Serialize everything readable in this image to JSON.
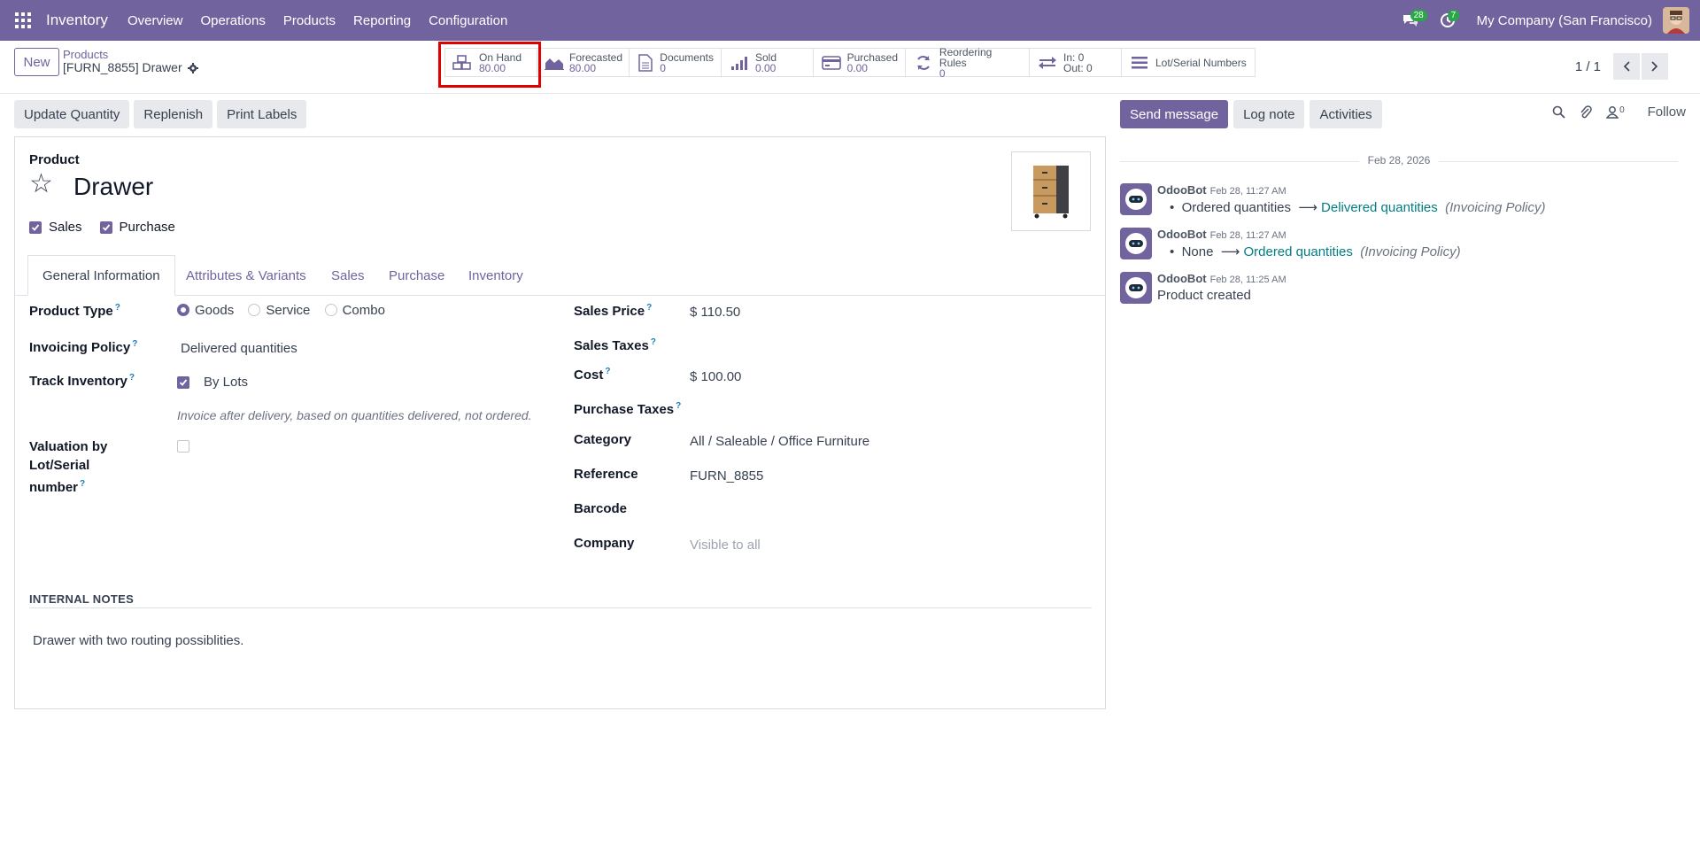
{
  "navbar": {
    "app_name": "Inventory",
    "menu": [
      "Overview",
      "Operations",
      "Products",
      "Reporting",
      "Configuration"
    ],
    "messages_count": "28",
    "activities_count": "7",
    "company": "My Company (San Francisco)"
  },
  "control": {
    "new_label": "New",
    "breadcrumb_parent": "Products",
    "breadcrumb_current": "[FURN_8855] Drawer",
    "pager": "1 / 1",
    "stats": [
      {
        "label": "On Hand",
        "value": "80.00",
        "icon": "cubes-icon"
      },
      {
        "label": "Forecasted",
        "value": "80.00",
        "icon": "area-chart-icon"
      },
      {
        "label": "Documents",
        "value": "0",
        "icon": "file-icon"
      },
      {
        "label": "Sold",
        "value": "0.00",
        "icon": "signal-icon"
      },
      {
        "label": "Purchased",
        "value": "0.00",
        "icon": "credit-card-icon"
      },
      {
        "label": "Reordering Rules",
        "value": "0",
        "icon": "refresh-icon"
      },
      {
        "label": "In: 0",
        "value": "Out: 0",
        "icon": "exchange-icon"
      },
      {
        "label": "Lot/Serial Numbers",
        "value": "",
        "icon": "bars-icon"
      }
    ]
  },
  "actions": [
    "Update Quantity",
    "Replenish",
    "Print Labels"
  ],
  "form": {
    "product_label": "Product",
    "name": "Drawer",
    "sales_label": "Sales",
    "purchase_label": "Purchase",
    "tabs": [
      "General Information",
      "Attributes & Variants",
      "Sales",
      "Purchase",
      "Inventory"
    ],
    "left": {
      "product_type_label": "Product Type",
      "product_type_options": [
        "Goods",
        "Service",
        "Combo"
      ],
      "invoicing_policy_label": "Invoicing Policy",
      "invoicing_policy_value": "Delivered quantities",
      "track_inventory_label": "Track Inventory",
      "track_inventory_value": "By Lots",
      "help_text": "Invoice after delivery, based on quantities delivered, not ordered.",
      "valuation_label_1": "Valuation by Lot/Serial",
      "valuation_label_2": "number"
    },
    "right": {
      "sales_price_label": "Sales Price",
      "sales_price_value": "$ 110.50",
      "sales_taxes_label": "Sales Taxes",
      "cost_label": "Cost",
      "cost_value": "$ 100.00",
      "purchase_taxes_label": "Purchase Taxes",
      "category_label": "Category",
      "category_value": "All / Saleable / Office Furniture",
      "reference_label": "Reference",
      "reference_value": "FURN_8855",
      "barcode_label": "Barcode",
      "company_label": "Company",
      "company_placeholder": "Visible to all"
    },
    "notes_title": "INTERNAL NOTES",
    "notes_body": "Drawer with two routing possiblities."
  },
  "chatter": {
    "send_message": "Send message",
    "log_note": "Log note",
    "activities": "Activities",
    "followers_count": "0",
    "follow": "Follow",
    "date": "Feb 28, 2026",
    "messages": [
      {
        "author": "OdooBot",
        "time": "Feb 28, 11:27 AM",
        "old": "Ordered quantities",
        "new": "Delivered quantities",
        "field": "(Invoicing Policy)"
      },
      {
        "author": "OdooBot",
        "time": "Feb 28, 11:27 AM",
        "old": "None",
        "new": "Ordered quantities",
        "field": "(Invoicing Policy)"
      },
      {
        "author": "OdooBot",
        "time": "Feb 28, 11:25 AM",
        "text": "Product created"
      }
    ]
  }
}
